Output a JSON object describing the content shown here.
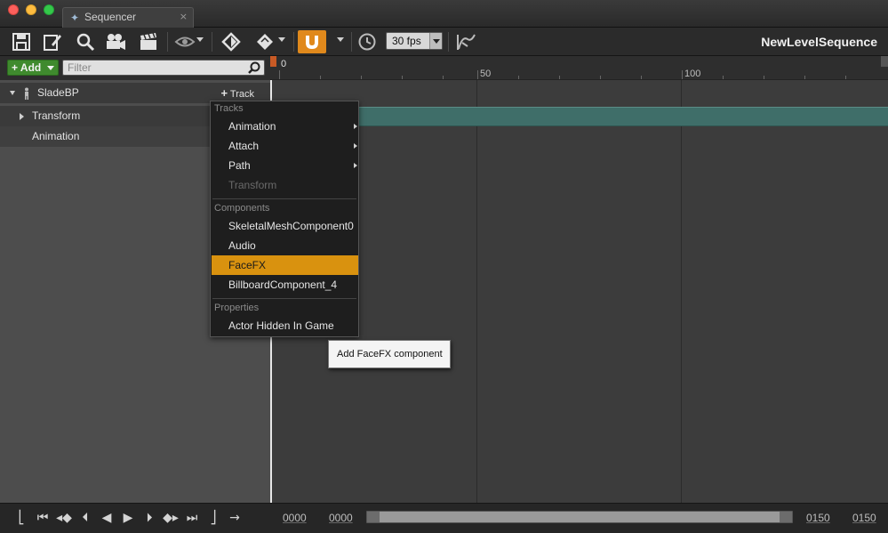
{
  "window": {
    "tab_title": "Sequencer",
    "tab_close": "×"
  },
  "toolbar": {
    "fps": "30 fps",
    "sequence_name": "NewLevelSequence",
    "accent_color": "#e0891c"
  },
  "outliner": {
    "add_label": "Add",
    "filter_placeholder": "Filter",
    "actor_name": "SladeBP",
    "track_button": "Track",
    "rows": [
      "Transform",
      "Animation"
    ]
  },
  "timeline": {
    "ruler_labels": [
      "0",
      "50",
      "100"
    ],
    "track_color": "#3f6e69"
  },
  "menu": {
    "sections": {
      "tracks": "Tracks",
      "components": "Components",
      "properties": "Properties"
    },
    "tracks_items": [
      {
        "label": "Animation",
        "submenu": true
      },
      {
        "label": "Attach",
        "submenu": true
      },
      {
        "label": "Path",
        "submenu": true
      },
      {
        "label": "Transform",
        "disabled": true
      }
    ],
    "component_items": [
      {
        "label": "SkeletalMeshComponent0"
      },
      {
        "label": "Audio"
      },
      {
        "label": "FaceFX",
        "highlighted": true
      },
      {
        "label": "BillboardComponent_4"
      }
    ],
    "property_items": [
      {
        "label": "Actor Hidden In Game"
      }
    ],
    "highlight_color": "#d9920f"
  },
  "tooltip": "Add FaceFX component",
  "bottom": {
    "view_start": "0000",
    "play_start": "0000",
    "play_end": "0150",
    "view_end": "0150"
  }
}
